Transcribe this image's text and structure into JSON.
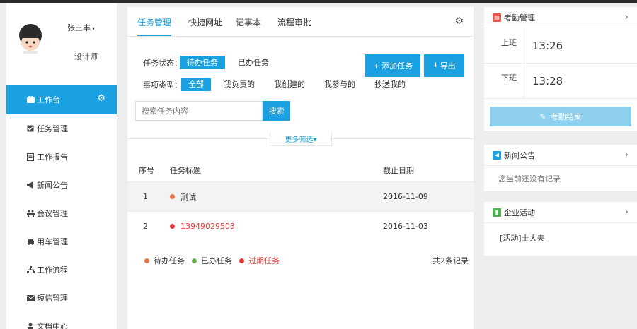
{
  "user": {
    "name": "张三丰",
    "role": "设计师",
    "caret": "▾"
  },
  "sidebar": {
    "items": [
      {
        "label": "工作台",
        "icon": "dashboard-icon",
        "active": true
      },
      {
        "label": "任务管理",
        "icon": "task-icon"
      },
      {
        "label": "工作报告",
        "icon": "report-icon"
      },
      {
        "label": "新闻公告",
        "icon": "megaphone-icon"
      },
      {
        "label": "会议管理",
        "icon": "meeting-icon"
      },
      {
        "label": "用车管理",
        "icon": "car-icon"
      },
      {
        "label": "工作流程",
        "icon": "workflow-icon"
      },
      {
        "label": "短信管理",
        "icon": "sms-icon"
      },
      {
        "label": "文档中心",
        "icon": "document-icon"
      }
    ]
  },
  "tabs": [
    "任务管理",
    "快捷网址",
    "记事本",
    "流程审批"
  ],
  "filter": {
    "status_label": "任务状态：",
    "status_options": [
      "待办任务",
      "已办任务"
    ],
    "type_label": "事项类型：",
    "type_options": [
      "全部",
      "我负责的",
      "我创建的",
      "我参与的",
      "抄送我的"
    ],
    "add_button": "添加任务",
    "add_icon": "+",
    "export_button": "导出",
    "export_icon": "⬇",
    "search_placeholder": "搜索任务内容",
    "search_button": "搜索",
    "more_filter": "更多筛选▾"
  },
  "table": {
    "headers": [
      "序号",
      "任务标题",
      "截止日期"
    ],
    "rows": [
      {
        "no": "1",
        "title": "测试",
        "date": "2016-11-09",
        "overdue": false
      },
      {
        "no": "2",
        "title": "13949029503",
        "date": "2016-11-03",
        "overdue": true
      }
    ]
  },
  "legend": [
    {
      "label": "待办任务",
      "color": "#e8734a"
    },
    {
      "label": "已办任务",
      "color": "#6ab04c"
    },
    {
      "label": "过期任务",
      "color": "#e53935"
    }
  ],
  "total": "共2条记录",
  "attendance": {
    "title": "考勤管理",
    "on_label": "上班",
    "on_time": "13:26",
    "off_label": "下班",
    "off_time": "13:28",
    "end_button": "考勤结束"
  },
  "news": {
    "title": "新闻公告",
    "empty": "您当前还没有记录"
  },
  "activity": {
    "title": "企业活动",
    "item": "[活动]士大夫"
  },
  "colors": {
    "accent": "#1ba1e2",
    "overdue": "#e53935",
    "light_button": "#8fd0ef"
  }
}
